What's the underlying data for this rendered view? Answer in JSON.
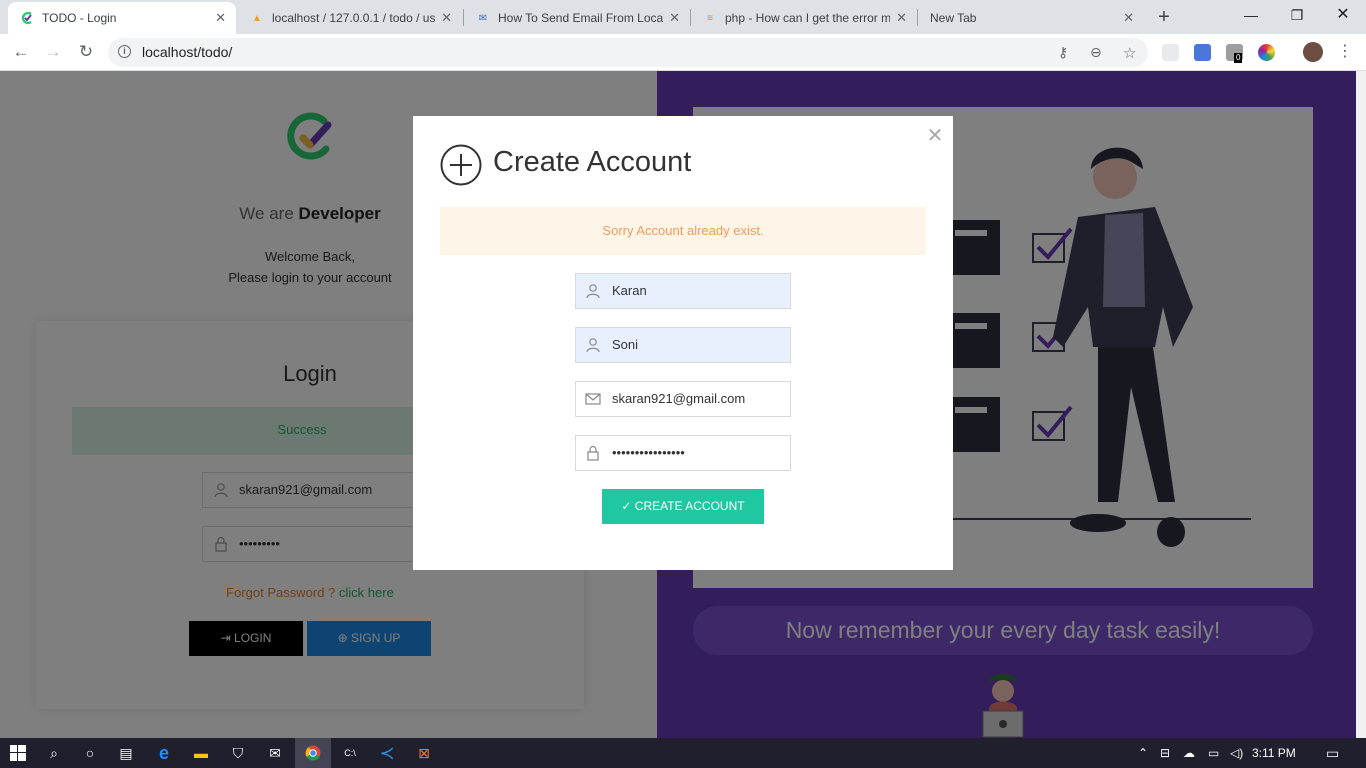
{
  "browser": {
    "tabs": [
      {
        "label": "TODO - Login",
        "icon": "todo-favicon",
        "active": true
      },
      {
        "label": "localhost / 127.0.0.1 / todo / us",
        "icon": "phpmyadmin-favicon",
        "active": false
      },
      {
        "label": "How To Send Email From Local",
        "icon": "site-favicon",
        "active": false
      },
      {
        "label": "php - How can I get the error m",
        "icon": "stackoverflow-favicon",
        "active": false
      },
      {
        "label": "New Tab",
        "icon": "",
        "active": false
      }
    ],
    "url": "localhost/todo/",
    "extension_badge": "0"
  },
  "left": {
    "we_are_prefix": "We are",
    "we_are_name": "Developer",
    "welcome_line1": "Welcome Back,",
    "welcome_line2": "Please login to your account",
    "login_title": "Login",
    "success_message": "Success",
    "email_value": "skaran921@gmail.com",
    "password_mask": "•••••••••",
    "forgot_text": "Forgot Password ?",
    "forgot_link": "click here",
    "login_button": "LOGIN",
    "signup_button": "SIGN UP"
  },
  "right": {
    "tagline": "Now remember your every day task easily!"
  },
  "modal": {
    "title": "Create Account",
    "alert": "Sorry Account already exist.",
    "first_name": "Karan",
    "last_name": "Soni",
    "email": "skaran921@gmail.com",
    "password_mask": "••••••••••••••••",
    "submit": "CREATE ACCOUNT"
  },
  "taskbar": {
    "time": "3:11 PM"
  },
  "colors": {
    "accent_purple": "#673ab7",
    "create_button": "#1fc8a0",
    "signup_button": "#1e88e5",
    "alert_text": "#f39c5a",
    "success_text": "#27ae60"
  }
}
